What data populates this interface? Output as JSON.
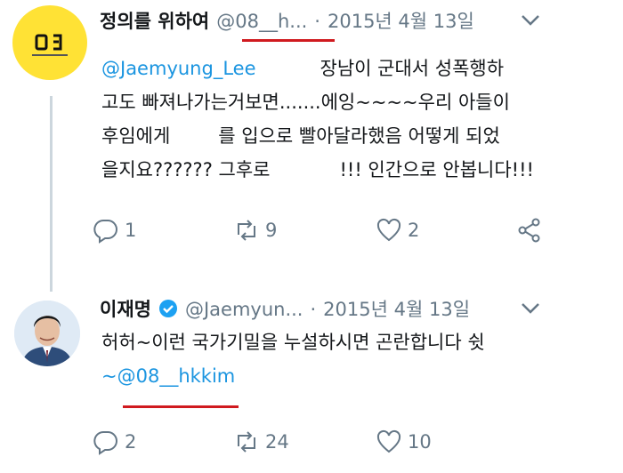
{
  "tweet1": {
    "name": "정의를 위하여",
    "handle": "@08__h...",
    "separator": "·",
    "date": "2015년 4월 13일",
    "lines": [
      {
        "mention": "@Jaemyung_Lee",
        "text": "장남이 군대서 성폭행하"
      },
      {
        "text": "고도 빠져나가는거보면.......에잉~~~~우리 아들이"
      },
      {
        "text_a": "후임에게",
        "text_b": "를 입으로 빨아달라했음 어떻게 되었"
      },
      {
        "text_a": "을지요?????? 그후로",
        "text_b": "!!!  인간으로 안봅니다!!!"
      }
    ],
    "reply_count": "1",
    "retweet_count": "9",
    "like_count": "2"
  },
  "tweet2": {
    "name": "이재명",
    "handle": "@Jaemyun...",
    "separator": "·",
    "date": "2015년 4월 13일",
    "line1": "허허~이런 국가기밀을 누설하시면 곤란합니다 쉿",
    "line2_prefix": "~",
    "line2_mention": "@08__hkkim",
    "reply_count": "2",
    "retweet_count": "24",
    "like_count": "10"
  },
  "icons": {
    "reply": "reply-icon",
    "retweet": "retweet-icon",
    "like": "heart-icon",
    "share": "share-icon",
    "more": "chevron-down-icon",
    "verified": "verified-badge-icon"
  },
  "colors": {
    "text": "#14171a",
    "muted": "#657786",
    "mention": "#1b95e0",
    "verified": "#1da1f2",
    "annotation_underline": "#d01a1f",
    "thread_line": "#ccd6dd",
    "avatar1_bg": "#ffe235"
  }
}
